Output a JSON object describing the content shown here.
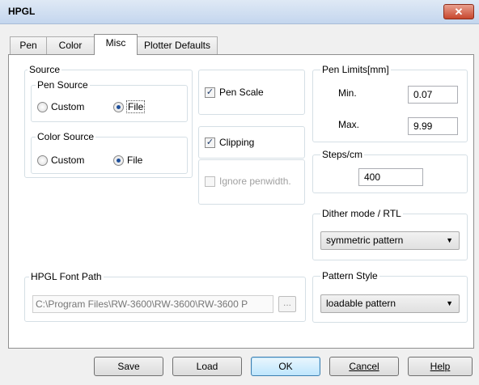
{
  "window": {
    "title": "HPGL",
    "close_glyph": "✕"
  },
  "tabs": [
    {
      "label": "Pen"
    },
    {
      "label": "Color"
    },
    {
      "label": "Misc"
    },
    {
      "label": "Plotter Defaults"
    }
  ],
  "source": {
    "title": "Source",
    "pen_source": {
      "title": "Pen Source",
      "option_custom": "Custom",
      "option_file": "File",
      "selected": "File"
    },
    "color_source": {
      "title": "Color Source",
      "option_custom": "Custom",
      "option_file": "File",
      "selected": "File"
    }
  },
  "options": {
    "pen_scale": {
      "label": "Pen Scale",
      "checked": true
    },
    "clipping": {
      "label": "Clipping",
      "checked": true
    },
    "ignore_penwidth": {
      "label": "Ignore penwidth.",
      "checked": false,
      "enabled": false
    }
  },
  "pen_limits": {
    "title": "Pen Limits[mm]",
    "min_label": "Min.",
    "min_value": "0.07",
    "max_label": "Max.",
    "max_value": "9.99"
  },
  "steps": {
    "title": "Steps/cm",
    "value": "400"
  },
  "dither": {
    "title": "Dither mode / RTL",
    "selected": "symmetric pattern"
  },
  "pattern": {
    "title": "Pattern Style",
    "selected": "loadable pattern"
  },
  "font_path": {
    "title": "HPGL Font Path",
    "value": "C:\\Program Files\\RW-3600\\RW-3600\\RW-3600 P",
    "browse_label": "..."
  },
  "buttons": {
    "save": "Save",
    "load": "Load",
    "ok": "OK",
    "cancel": "Cancel",
    "help": "Help"
  },
  "icons": {
    "check": "✓",
    "dropdown": "▼"
  }
}
